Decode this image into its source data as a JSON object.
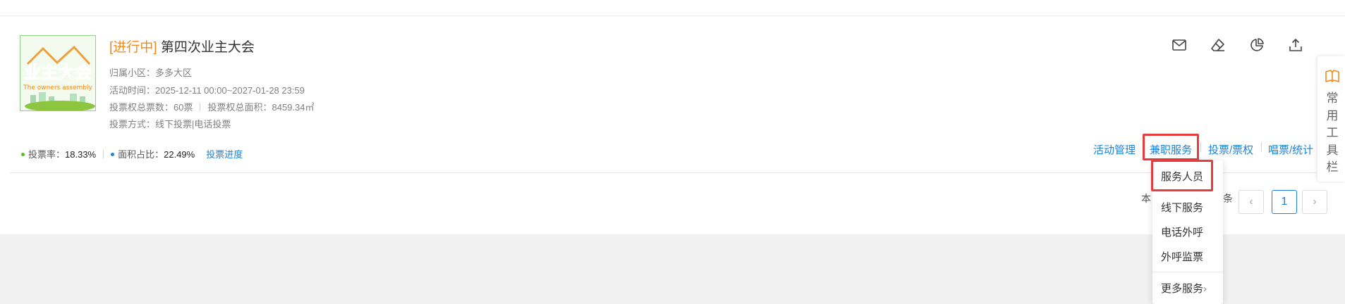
{
  "event": {
    "status_tag": "[进行中]",
    "title": "第四次业主大会",
    "logo": {
      "line1": "业主大会",
      "line2": "The owners assembly"
    },
    "community_label": "归属小区：",
    "community_value": "多多大区",
    "time_label": "活动时间：",
    "time_value": "2025-12-11 00:00~2027-01-28 23:59",
    "votes_label": "投票权总票数：",
    "votes_value": "60票",
    "area_label": "投票权总面积：",
    "area_value": "8459.34㎡",
    "method_label": "投票方式：",
    "method_value": "线下投票|电话投票"
  },
  "stats": {
    "vote_rate_label": "投票率：",
    "vote_rate_value": "18.33%",
    "area_ratio_label": "面积占比：",
    "area_ratio_value": "22.49%",
    "progress_link": "投票进度",
    "colors": {
      "vote_dot": "#52c41a",
      "area_dot": "#1a82d8"
    }
  },
  "icons": [
    "mail-icon",
    "eraser-icon",
    "pie-chart-icon",
    "upload-icon"
  ],
  "actions": {
    "manage": "活动管理",
    "part_time": "兼职服务",
    "vote": "投票/票权",
    "count": "唱票/统计"
  },
  "dropdown": {
    "items": [
      "服务人员",
      "线下服务",
      "电话外呼",
      "外呼监票"
    ],
    "more": "更多服务",
    "more_arrow": "›"
  },
  "pagination": {
    "partial_text_left": "本",
    "partial_text_right": "条",
    "prev": "‹",
    "current_page": "1",
    "next": "›"
  },
  "toolbar": {
    "label": "常用工具栏",
    "icon": "book-icon"
  },
  "colors": {
    "accent": "#1a82d8",
    "status": "#f08a1d",
    "highlight": "#e53d3d"
  }
}
